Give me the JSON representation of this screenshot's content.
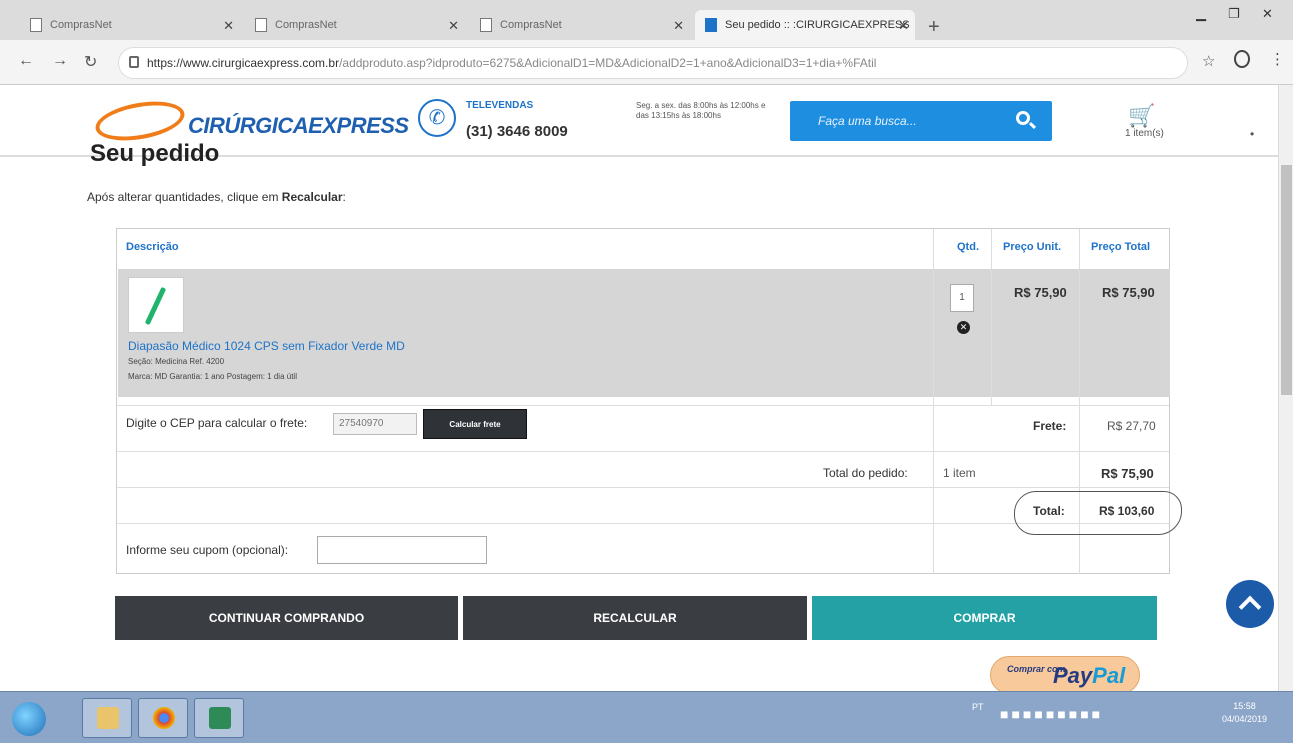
{
  "browser": {
    "tabs": [
      {
        "title": "ComprasNet",
        "active": false
      },
      {
        "title": "ComprasNet",
        "active": false
      },
      {
        "title": "ComprasNet",
        "active": false
      },
      {
        "title": "Seu pedido :: :CIRURGICAEXPRESS",
        "active": true
      }
    ],
    "url_host": "https://www.cirurgicaexpress.com.br",
    "url_path": "/addproduto.asp?idproduto=6275&AdicionalD1=MD&AdicionalD2=1+ano&AdicionalD3=1+dia+%FAtil"
  },
  "header": {
    "logo_brand": "CIRÚRGICA",
    "logo_suffix": "EXPRESS",
    "televendas_label": "TELEVENDAS",
    "phone": "(31) 3646 8009",
    "hours": "Seg. a sex. das 8:00hs às 12:00hs e das 13:15hs às 18:00hs",
    "search_placeholder": "Faça uma busca...",
    "cart_count": "1 item(s)"
  },
  "page": {
    "title": "Seu pedido",
    "hint_prefix": "Após alterar quantidades, clique em ",
    "hint_bold": "Recalcular",
    "hint_suffix": ":"
  },
  "table": {
    "headers": {
      "descricao": "Descrição",
      "qtd": "Qtd.",
      "preco_unit": "Preço Unit.",
      "preco_total": "Preço Total"
    },
    "item": {
      "name": "Diapasão Médico 1024 CPS sem Fixador Verde MD",
      "meta_1": "Seção: Medicina   Ref. 4200",
      "meta_2": "Marca:  MD Garantia:  1 ano Postagem:  1 dia útil",
      "qty": "1",
      "unit_price": "R$ 75,90",
      "total_price": "R$ 75,90"
    },
    "cep_label": "Digite o CEP para calcular o frete:",
    "cep_value": "27540970",
    "calc_button": "Calcular frete",
    "frete_label": "Frete:",
    "frete_value": "R$ 27,70",
    "total_pedido_label": "Total do pedido:",
    "total_pedido_items": "1 item",
    "total_pedido_value": "R$ 75,90",
    "total_label": "Total:",
    "total_value": "R$ 103,60",
    "cupom_label": "Informe seu cupom (opcional):"
  },
  "actions": {
    "continue": "CONTINUAR COMPRANDO",
    "recalc": "RECALCULAR",
    "buy": "COMPRAR"
  },
  "paypal": {
    "small": "Comprar com",
    "big_pay": "Pay",
    "big_pal": "Pal"
  },
  "taskbar": {
    "lang": "PT",
    "time": "15:58",
    "date": "04/04/2019"
  },
  "colors": {
    "accent": "#1e73c8",
    "buy": "#23a1a5",
    "dark_button": "#3a3d42",
    "product_row": "#d6d6d6"
  }
}
